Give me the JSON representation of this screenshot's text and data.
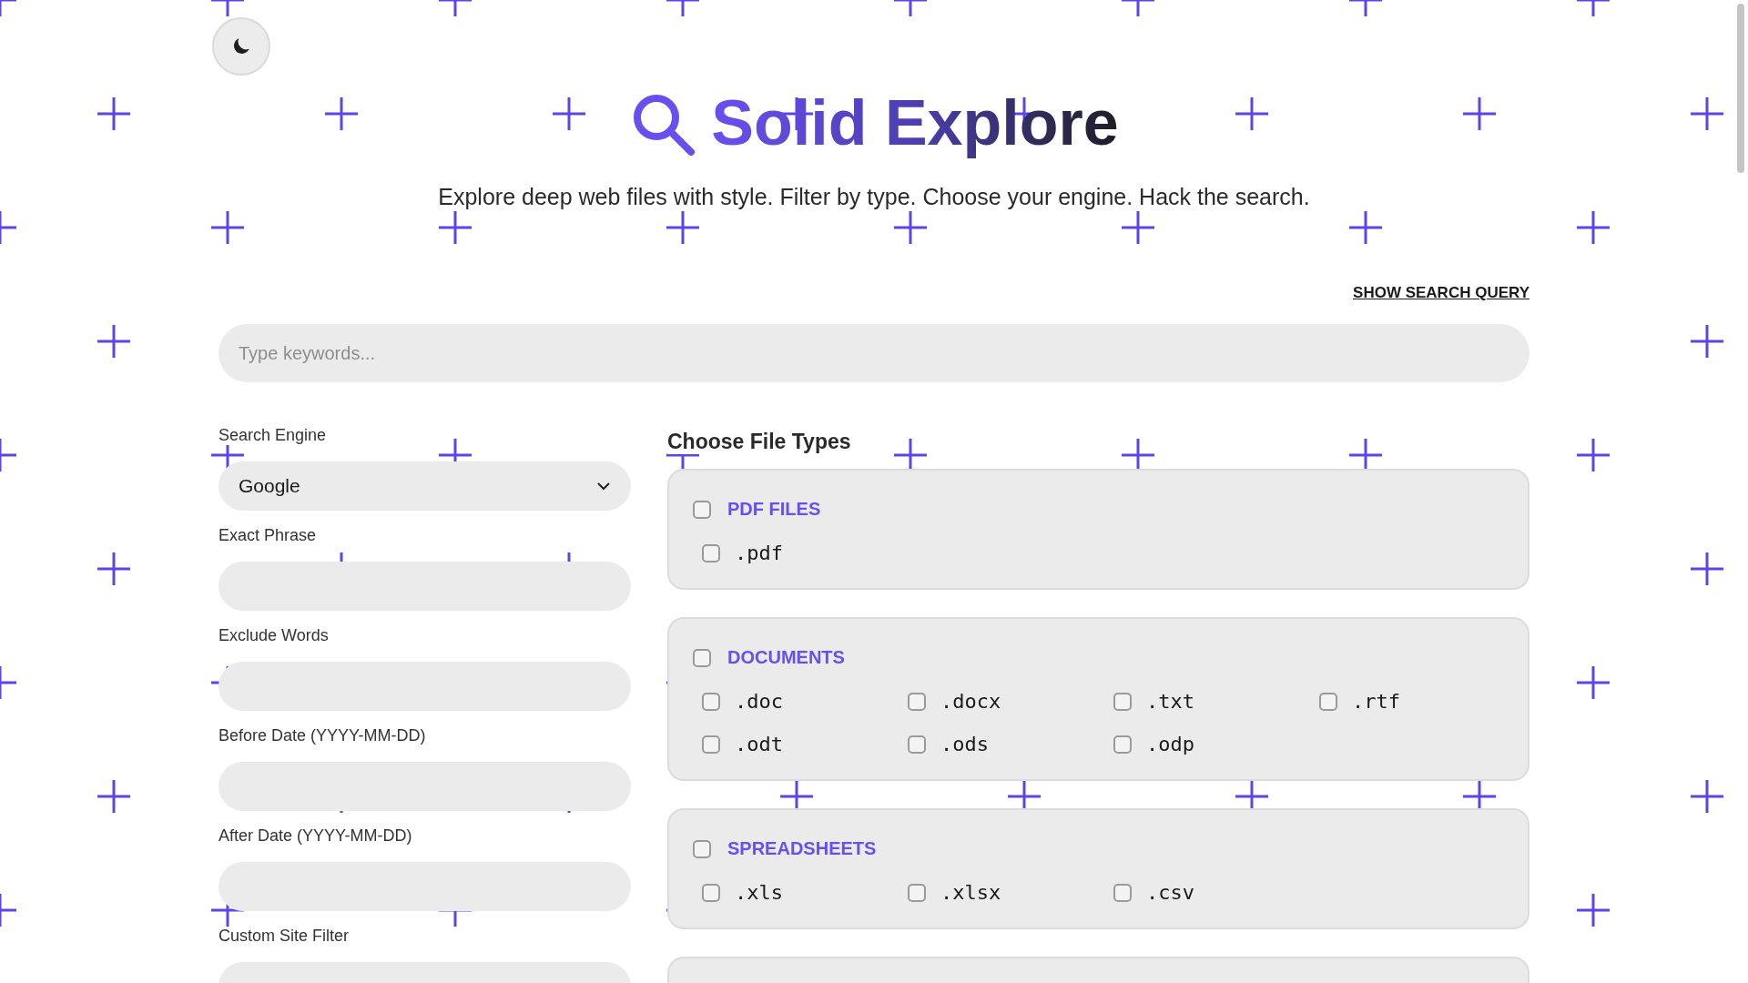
{
  "title": "Solid Explore",
  "subtitle": "Explore deep web files with style. Filter by type. Choose your engine. Hack the search.",
  "show_query_link": "SHOW SEARCH QUERY",
  "search": {
    "placeholder": "Type keywords..."
  },
  "filters": [
    {
      "kind": "select",
      "label": "Search Engine",
      "value": "Google"
    },
    {
      "kind": "text",
      "label": "Exact Phrase"
    },
    {
      "kind": "text",
      "label": "Exclude Words"
    },
    {
      "kind": "text",
      "label": "Before Date (YYYY-MM-DD)"
    },
    {
      "kind": "text",
      "label": "After Date (YYYY-MM-DD)"
    },
    {
      "kind": "text",
      "label": "Custom Site Filter"
    }
  ],
  "file_types": {
    "heading": "Choose File Types",
    "groups": [
      {
        "title": "PDF FILES",
        "checked": false,
        "options": [
          {
            "label": ".pdf",
            "checked": false
          }
        ]
      },
      {
        "title": "DOCUMENTS",
        "checked": false,
        "options": [
          {
            "label": ".doc",
            "checked": false
          },
          {
            "label": ".docx",
            "checked": false
          },
          {
            "label": ".txt",
            "checked": false
          },
          {
            "label": ".rtf",
            "checked": false
          },
          {
            "label": ".odt",
            "checked": false
          },
          {
            "label": ".ods",
            "checked": false
          },
          {
            "label": ".odp",
            "checked": false
          }
        ]
      },
      {
        "title": "SPREADSHEETS",
        "checked": false,
        "options": [
          {
            "label": ".xls",
            "checked": false
          },
          {
            "label": ".xlsx",
            "checked": false
          },
          {
            "label": ".csv",
            "checked": false
          }
        ]
      }
    ]
  }
}
